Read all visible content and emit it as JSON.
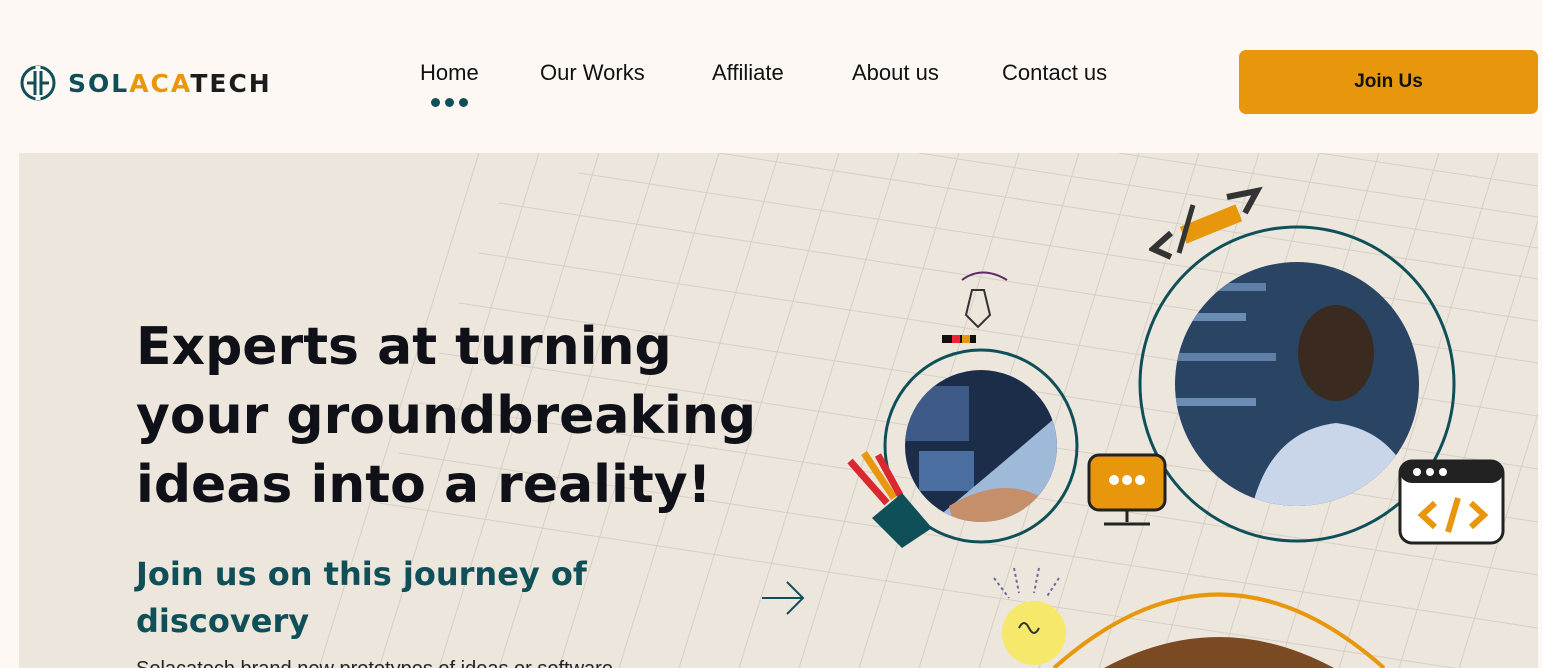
{
  "brand": {
    "name_part1": "SOL",
    "name_part2": "ACA",
    "name_part3": "TECH"
  },
  "nav": {
    "items": [
      {
        "label": "Home",
        "active": true
      },
      {
        "label": "Our Works",
        "active": false
      },
      {
        "label": "Affiliate",
        "active": false
      },
      {
        "label": "About us",
        "active": false
      },
      {
        "label": "Contact us",
        "active": false
      }
    ]
  },
  "header": {
    "cta_label": "Join Us"
  },
  "hero": {
    "headline": "Experts at turning your groundbreaking ideas into a reality!",
    "subheadline": "Join us on this journey of discovery",
    "body_partial": "Solacatech brand new prototypes of ideas or software"
  },
  "colors": {
    "brand_teal": "#0f5058",
    "brand_orange": "#e8970c",
    "page_bg": "#fdf8f3",
    "hero_bg": "#ece6dd",
    "brown": "#7a4a23"
  },
  "icons": [
    "logo-mark-icon",
    "arrow-right-icon",
    "pen-tool-icon",
    "pencil-code-icon",
    "code-window-icon",
    "monitor-chat-icon",
    "pen-holder-icon",
    "lightbulb-icon"
  ]
}
